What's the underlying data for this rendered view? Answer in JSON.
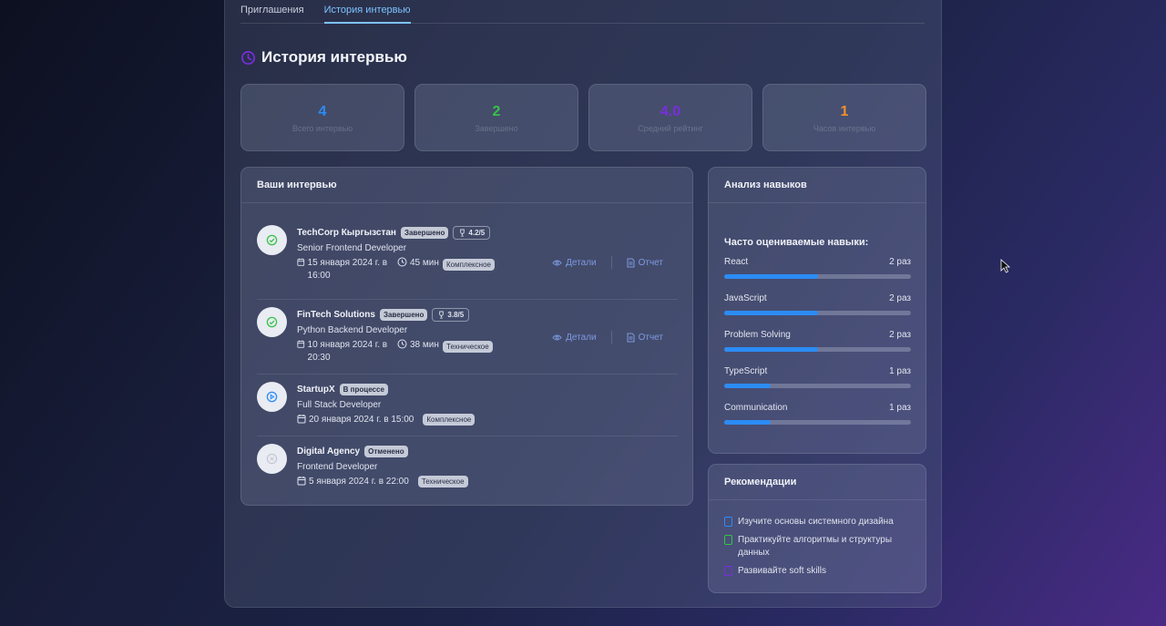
{
  "tabs": [
    {
      "label": "Приглашения",
      "active": false
    },
    {
      "label": "История интервью",
      "active": true
    }
  ],
  "page_title": "История интервью",
  "stats": [
    {
      "value": "4",
      "label": "Всего интервью",
      "color": "#2b8cf5"
    },
    {
      "value": "2",
      "label": "Завершено",
      "color": "#36c24a"
    },
    {
      "value": "4.0",
      "label": "Средний рейтинг",
      "color": "#7a2de0"
    },
    {
      "value": "1",
      "label": "Часов интервью",
      "color": "#f2902a"
    }
  ],
  "interviews_panel": {
    "title": "Ваши интервью",
    "details_label": "Детали",
    "report_label": "Отчет",
    "items": [
      {
        "company": "TechCorp Кыргызстан",
        "status": "Завершено",
        "status_icon": "check-circle-icon",
        "icon_color": "#36c24a",
        "rating": "4.2/5",
        "position": "Senior Frontend Developer",
        "date": "15 января 2024 г. в 16:00",
        "duration": "45 мин",
        "type": "Комплексное",
        "has_actions": true
      },
      {
        "company": "FinTech Solutions",
        "status": "Завершено",
        "status_icon": "check-circle-icon",
        "icon_color": "#36c24a",
        "rating": "3.8/5",
        "position": "Python Backend Developer",
        "date": "10 января 2024 г. в 20:30",
        "duration": "38 мин",
        "type": "Техническое",
        "has_actions": true
      },
      {
        "company": "StartupX",
        "status": "В процессе",
        "status_icon": "play-circle-icon",
        "icon_color": "#2b8cf5",
        "position": "Full Stack Developer",
        "date": "20 января 2024 г. в 15:00",
        "type": "Комплексное",
        "has_actions": false
      },
      {
        "company": "Digital Agency",
        "status": "Отменено",
        "status_icon": "cancel-circle-icon",
        "icon_color": "#c0c4cf",
        "position": "Frontend Developer",
        "date": "5 января 2024 г. в 22:00",
        "type": "Техническое",
        "has_actions": false
      }
    ]
  },
  "skills_panel": {
    "title": "Анализ навыков",
    "subtitle": "Часто оцениваемые навыки:",
    "items": [
      {
        "name": "React",
        "count": "2 раз",
        "fraction": 0.5
      },
      {
        "name": "JavaScript",
        "count": "2 раз",
        "fraction": 0.5
      },
      {
        "name": "Problem Solving",
        "count": "2 раз",
        "fraction": 0.5
      },
      {
        "name": "TypeScript",
        "count": "1 раз",
        "fraction": 0.25
      },
      {
        "name": "Communication",
        "count": "1 раз",
        "fraction": 0.25
      }
    ]
  },
  "recommendations_panel": {
    "title": "Рекомендации",
    "items": [
      {
        "text": "Изучите основы системного дизайна",
        "icon": "book-icon",
        "color": "#2b8cf5"
      },
      {
        "text": "Практикуйте алгоритмы и структуры данных",
        "icon": "code-icon",
        "color": "#36c24a"
      },
      {
        "text": "Развивайте soft skills",
        "icon": "people-icon",
        "color": "#7a2de0"
      }
    ]
  }
}
